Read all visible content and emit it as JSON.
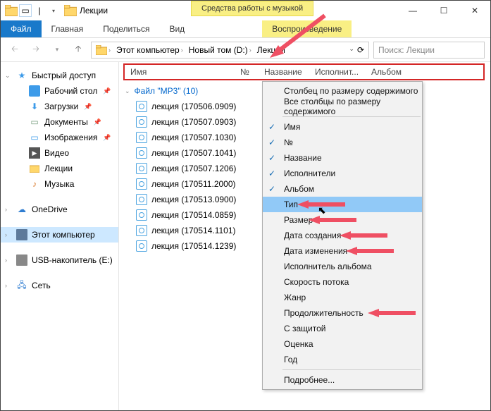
{
  "window": {
    "title": "Лекции",
    "music_tools": "Средства работы с музыкой"
  },
  "ribbon": {
    "file": "Файл",
    "home": "Главная",
    "share": "Поделиться",
    "view": "Вид",
    "play": "Воспроизведение"
  },
  "addr": {
    "this_pc": "Этот компьютер",
    "drive": "Новый том (D:)",
    "folder": "Лекции"
  },
  "search": {
    "placeholder": "Поиск: Лекции"
  },
  "columns": {
    "name": "Имя",
    "num": "№",
    "title": "Название",
    "artist": "Исполнит...",
    "album": "Альбом"
  },
  "group": {
    "label": "Файл \"MP3\" (10)"
  },
  "files": [
    "лекция (170506.0909)",
    "лекция (170507.0903)",
    "лекция (170507.1030)",
    "лекция (170507.1041)",
    "лекция (170507.1206)",
    "лекция (170511.2000)",
    "лекция (170513.0900)",
    "лекция (170514.0859)",
    "лекция (170514.1101)",
    "лекция (170514.1239)"
  ],
  "nav": {
    "quick": "Быстрый доступ",
    "desktop": "Рабочий стол",
    "downloads": "Загрузки",
    "documents": "Документы",
    "pictures": "Изображения",
    "video": "Видео",
    "lectures": "Лекции",
    "music": "Музыка",
    "onedrive": "OneDrive",
    "this_pc": "Этот компьютер",
    "usb": "USB-накопитель (E:)",
    "network": "Сеть"
  },
  "menu": {
    "size_col": "Столбец по размеру содержимого",
    "size_all": "Все столбцы по размеру содержимого",
    "name": "Имя",
    "num": "№",
    "title": "Название",
    "artists": "Исполнители",
    "album": "Альбом",
    "type": "Тип",
    "size": "Размер",
    "date_created": "Дата создания",
    "date_modified": "Дата изменения",
    "album_artist": "Исполнитель альбома",
    "bitrate": "Скорость потока",
    "genre": "Жанр",
    "length": "Продолжительность",
    "protected": "С защитой",
    "rating": "Оценка",
    "year": "Год",
    "more": "Подробнее..."
  }
}
